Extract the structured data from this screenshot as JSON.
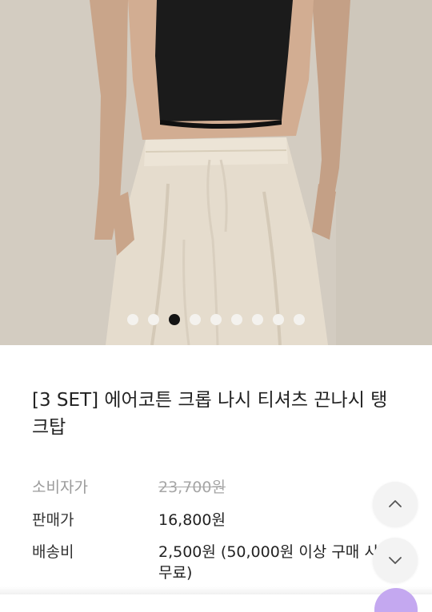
{
  "gallery": {
    "total_images": 9,
    "active_index": 2
  },
  "product": {
    "title": "[3 SET] 에어코튼 크롭 나시 티셔츠 끈나시 탱크탑"
  },
  "prices": {
    "consumer_label": "소비자가",
    "consumer_value": "23,700원",
    "sale_label": "판매가",
    "sale_value": "16,800원",
    "shipping_label": "배송비",
    "shipping_value": "2,500원 (50,000원 이상 구매 시 무료)"
  },
  "icons": {
    "scroll_up": "chevron-up-icon",
    "scroll_down": "chevron-down-icon"
  },
  "colors": {
    "active_dot": "#141414",
    "inactive_dot": "#f4f2ee",
    "strikethrough_price": "#a6a6a6"
  }
}
